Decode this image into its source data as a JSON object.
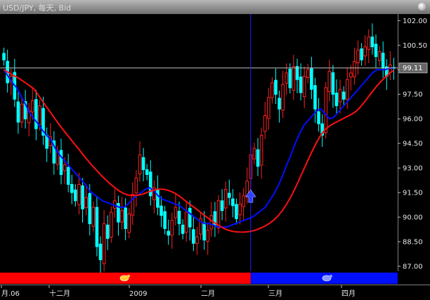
{
  "window": {
    "title": "USD/JPY, 每天, Bid"
  },
  "colors": {
    "bull": "#ff2020",
    "bear": "#00ffff",
    "ma_fast": "#0010ff",
    "ma_slow": "#ff1010",
    "cursor": "#2020ff",
    "price_line": "#c0c0c0",
    "bg": "#000000",
    "axis": "#e6e6e6"
  },
  "chart_data": {
    "type": "candlestick",
    "title": "USD/JPY, 每天, Bid",
    "y_ticks": [
      "102.00",
      "100.50",
      "99.00",
      "97.50",
      "96.00",
      "94.50",
      "93.00",
      "91.50",
      "90.00",
      "88.50",
      "87.00"
    ],
    "x_ticks": [
      "月.06",
      "十二月",
      "2009",
      "二月",
      "三月",
      "四月"
    ],
    "ylim": [
      86.7,
      102.4
    ],
    "current_price": "99.11",
    "close": [
      99.6,
      98.2,
      98.6,
      97.2,
      95.8,
      96.9,
      96.0,
      96.5,
      97.1,
      95.4,
      96.8,
      95.0,
      94.2,
      94.9,
      93.3,
      94.0,
      92.6,
      93.2,
      92.0,
      91.5,
      91.0,
      92.0,
      90.5,
      91.2,
      89.6,
      90.6,
      88.2,
      87.4,
      89.6,
      88.7,
      90.3,
      91.0,
      89.7,
      90.4,
      89.3,
      90.2,
      91.4,
      92.4,
      93.8,
      92.9,
      92.6,
      91.3,
      91.8,
      90.6,
      90.1,
      89.3,
      88.9,
      89.8,
      90.6,
      89.6,
      89.0,
      90.3,
      89.4,
      88.4,
      88.8,
      89.9,
      88.6,
      89.2,
      90.1,
      89.5,
      91.0,
      90.4,
      91.7,
      91.2,
      90.7,
      89.9,
      90.8,
      91.3,
      92.2,
      93.8,
      94.2,
      93.1,
      95.0,
      96.2,
      97.3,
      98.2,
      97.5,
      96.6,
      98.1,
      98.8,
      97.9,
      99.2,
      98.4,
      97.6,
      98.6,
      99.0,
      97.8,
      96.6,
      95.7,
      95.0,
      97.9,
      98.9,
      97.5,
      96.8,
      97.8,
      97.2,
      98.4,
      98.8,
      99.5,
      100.2,
      99.6,
      100.4,
      101.0,
      100.4,
      99.8,
      100.1,
      99.1,
      98.6,
      99.3,
      99.1
    ],
    "ma_fast": [
      99.0,
      98.6,
      98.2,
      97.9,
      97.4,
      96.9,
      96.4,
      96.0,
      95.7,
      95.3,
      95.0,
      94.7,
      94.2,
      93.8,
      93.5,
      93.2,
      92.9,
      92.6,
      92.3,
      92.0,
      91.6,
      91.4,
      91.2,
      91.0,
      90.9,
      90.8,
      90.7,
      90.6,
      90.6,
      90.8,
      91.1,
      91.3,
      91.5,
      91.7,
      91.8,
      91.6,
      91.3,
      91.1,
      91.0,
      90.9,
      90.8,
      90.7,
      90.5,
      90.3,
      90.1,
      89.9,
      89.7,
      89.6,
      89.6,
      89.5,
      89.4,
      89.4,
      89.4,
      89.5,
      89.6,
      89.7,
      89.8,
      89.9,
      90.0,
      90.2,
      90.4,
      90.6,
      91.0,
      91.4,
      91.9,
      92.5,
      93.2,
      93.8,
      94.5,
      95.1,
      95.6,
      95.9,
      96.2,
      96.5,
      96.6,
      96.3,
      96.0,
      96.1,
      96.4,
      96.7,
      97.0,
      97.3,
      97.6,
      97.9,
      98.2,
      98.5,
      98.8,
      99.0,
      99.0,
      99.0,
      99.1,
      99.1
    ]
  }
}
